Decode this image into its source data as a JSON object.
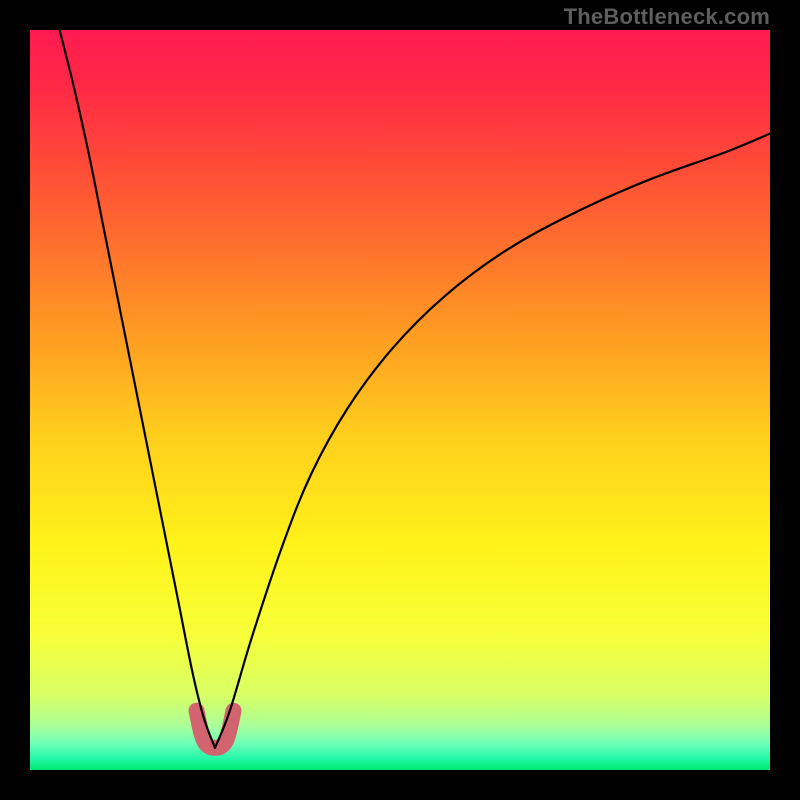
{
  "watermark": "TheBottleneck.com",
  "gradient": {
    "stops": [
      {
        "offset": 0.0,
        "color": "#ff1a50"
      },
      {
        "offset": 0.08,
        "color": "#ff2a45"
      },
      {
        "offset": 0.18,
        "color": "#ff4a38"
      },
      {
        "offset": 0.3,
        "color": "#ff732c"
      },
      {
        "offset": 0.42,
        "color": "#ff9f22"
      },
      {
        "offset": 0.55,
        "color": "#ffcf1c"
      },
      {
        "offset": 0.7,
        "color": "#fff31a"
      },
      {
        "offset": 0.82,
        "color": "#f6ff3a"
      },
      {
        "offset": 0.9,
        "color": "#d8ff66"
      },
      {
        "offset": 0.94,
        "color": "#aaff99"
      },
      {
        "offset": 0.965,
        "color": "#6cffba"
      },
      {
        "offset": 0.985,
        "color": "#22f7a6"
      },
      {
        "offset": 1.0,
        "color": "#00e872"
      }
    ]
  },
  "pink_stub": {
    "color": "#d1646f",
    "stroke_width": 16
  },
  "curve_style": {
    "stroke": "#000000",
    "stroke_width": 2.2
  },
  "chart_data": {
    "type": "line",
    "title": "",
    "xlabel": "",
    "ylabel": "",
    "xlim": [
      0,
      100
    ],
    "ylim": [
      0,
      100
    ],
    "notes": "Black V-shaped curve on vertical red→green gradient. Left arm starts near top-left and dives to minimum; right arm rises with decreasing slope toward top-right. Minimum at x≈25, y≈3. Short pink U-shaped stub overlays the valley bottom (x≈23–28, y≈3–8). Green band occupies roughly y<4; yellow band roughly 4–30; orange/red above.",
    "series": [
      {
        "name": "left-arm",
        "x": [
          4,
          6,
          8,
          10,
          12,
          14,
          16,
          18,
          20,
          22,
          23.5,
          25
        ],
        "y": [
          100,
          92,
          83,
          73,
          63,
          53,
          43,
          33,
          23,
          13,
          7,
          3
        ]
      },
      {
        "name": "right-arm",
        "x": [
          25,
          27,
          30,
          34,
          38,
          43,
          49,
          56,
          64,
          73,
          83,
          94,
          100
        ],
        "y": [
          3,
          8,
          18,
          30,
          40,
          49,
          57,
          64,
          70,
          75,
          79.5,
          83.5,
          86
        ]
      },
      {
        "name": "pink-stub",
        "x": [
          22.5,
          23.5,
          25,
          26.5,
          27.5
        ],
        "y": [
          8,
          4,
          3,
          4,
          8
        ]
      }
    ]
  }
}
